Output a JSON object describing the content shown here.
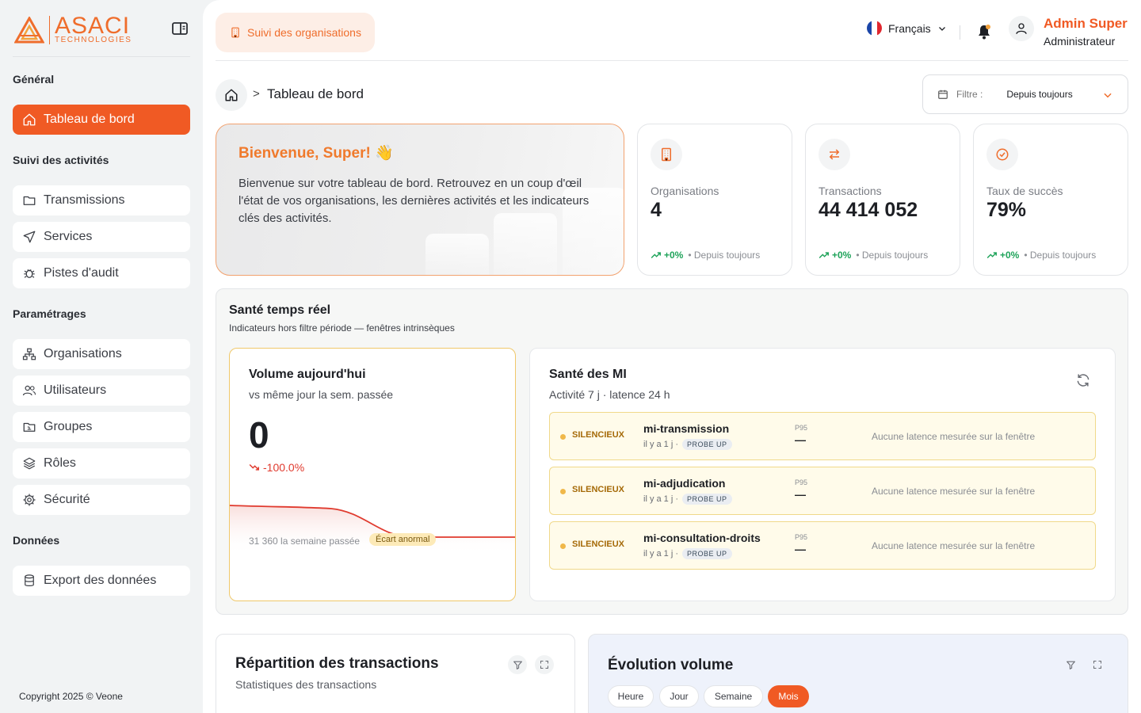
{
  "logo": {
    "main": "ASACI",
    "sub": "TECHNOLOGIES"
  },
  "sidebar": {
    "sections": {
      "general": "Général",
      "activities": "Suivi des activités",
      "settings": "Paramétrages",
      "data": "Données"
    },
    "items": [
      {
        "label": "Tableau de bord",
        "icon": "home-icon"
      },
      {
        "label": "Transmissions",
        "icon": "folder-icon"
      },
      {
        "label": "Services",
        "icon": "send-icon"
      },
      {
        "label": "Pistes d'audit",
        "icon": "bug-icon"
      },
      {
        "label": "Organisations",
        "icon": "sitemap-icon"
      },
      {
        "label": "Utilisateurs",
        "icon": "users-icon"
      },
      {
        "label": "Groupes",
        "icon": "folder-group-icon"
      },
      {
        "label": "Rôles",
        "icon": "layers-icon"
      },
      {
        "label": "Sécurité",
        "icon": "gear-icon"
      },
      {
        "label": "Export des données",
        "icon": "database-icon"
      }
    ],
    "copyright": "Copyright 2025 © Veone"
  },
  "header": {
    "top_button": "Suivi des organisations",
    "language": "Français",
    "user_name": "Admin Super",
    "user_role": "Administrateur"
  },
  "breadcrumb": {
    "current": "Tableau de bord",
    "separator": ">"
  },
  "filter": {
    "label": "Filtre :",
    "value": "Depuis toujours"
  },
  "welcome": {
    "title": "Bienvenue, Super! 👋",
    "text": "Bienvenue sur votre tableau de bord. Retrouvez en un coup d'œil l'état de vos organisations, les dernières activités et les indicateurs clés des activités."
  },
  "stats": [
    {
      "label": "Organisations",
      "value": "4",
      "pct": "+0%",
      "since": "• Depuis toujours"
    },
    {
      "label": "Transactions",
      "value": "44 414 052",
      "pct": "+0%",
      "since": "• Depuis toujours"
    },
    {
      "label": "Taux de succès",
      "value": "79%",
      "pct": "+0%",
      "since": "• Depuis toujours"
    }
  ],
  "health": {
    "title": "Santé temps réel",
    "subtitle": "Indicateurs hors filtre période — fenêtres intrinsèques",
    "volume": {
      "title": "Volume aujourd'hui",
      "subtitle": "vs même jour la sem. passée",
      "value": "0",
      "change": "-100.0%",
      "last_week": "31 360 la semaine passée",
      "badge": "Écart anormal"
    },
    "mi": {
      "title": "Santé des MI",
      "subtitle": "Activité 7 j · latence 24 h",
      "rows": [
        {
          "status": "SILENCIEUX",
          "name": "mi-transmission",
          "ago": "il y a 1 j ·",
          "probe": "PROBE UP",
          "p95_label": "P95",
          "p95": "—",
          "note": "Aucune latence mesurée sur la fenêtre"
        },
        {
          "status": "SILENCIEUX",
          "name": "mi-adjudication",
          "ago": "il y a 1 j ·",
          "probe": "PROBE UP",
          "p95_label": "P95",
          "p95": "—",
          "note": "Aucune latence mesurée sur la fenêtre"
        },
        {
          "status": "SILENCIEUX",
          "name": "mi-consultation-droits",
          "ago": "il y a 1 j ·",
          "probe": "PROBE UP",
          "p95_label": "P95",
          "p95": "—",
          "note": "Aucune latence mesurée sur la fenêtre"
        }
      ]
    }
  },
  "repartition": {
    "title": "Répartition des transactions",
    "subtitle": "Statistiques des transactions"
  },
  "evolution": {
    "title": "Évolution volume",
    "tabs": [
      "Heure",
      "Jour",
      "Semaine",
      "Mois"
    ],
    "active_tab": "Mois"
  },
  "colors": {
    "accent": "#f05a24",
    "success": "#1fa35a",
    "danger": "#e03a2e",
    "warning": "#f0b84a"
  }
}
